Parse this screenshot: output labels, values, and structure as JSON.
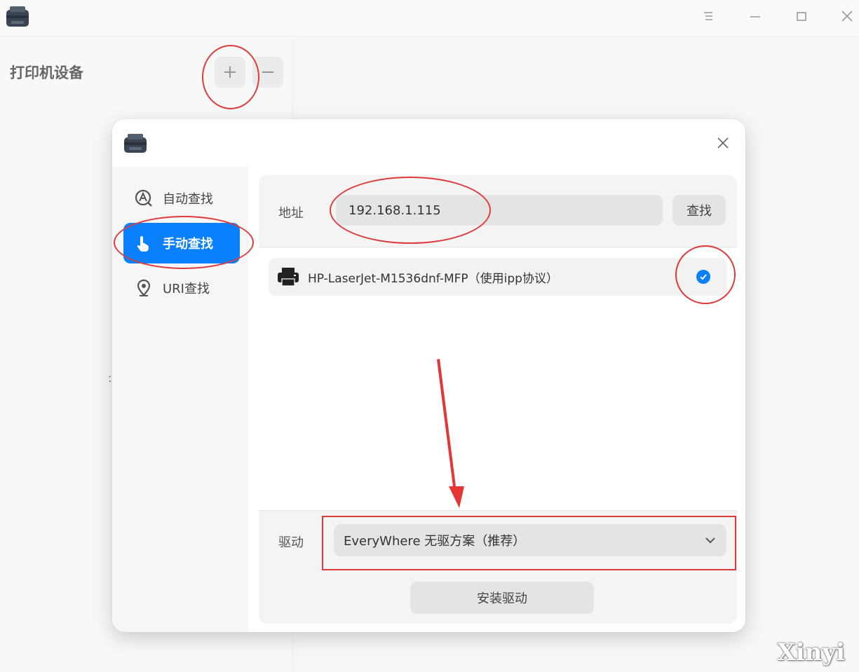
{
  "device_panel": {
    "title": "打印机设备",
    "add_label": "+",
    "remove_label": "−"
  },
  "dialog": {
    "sidebar": {
      "items": [
        {
          "label": "自动查找",
          "icon": "auto-search-icon",
          "active": false
        },
        {
          "label": "手动查找",
          "icon": "hand-pointer-icon",
          "active": true
        },
        {
          "label": "URI查找",
          "icon": "location-pin-icon",
          "active": false
        }
      ]
    },
    "address": {
      "label": "地址",
      "value": "192.168.1.115",
      "search_label": "查找"
    },
    "results": [
      {
        "name": "HP-LaserJet-M1536dnf-MFP（使用ipp协议）",
        "selected": true
      }
    ],
    "driver": {
      "label": "驱动",
      "selected": "EveryWhere 无驱方案（推荐）"
    },
    "install_label": "安装驱动"
  },
  "watermark": "Xinyi",
  "colors": {
    "accent": "#0a80ff",
    "annotation": "#e03a3a"
  }
}
